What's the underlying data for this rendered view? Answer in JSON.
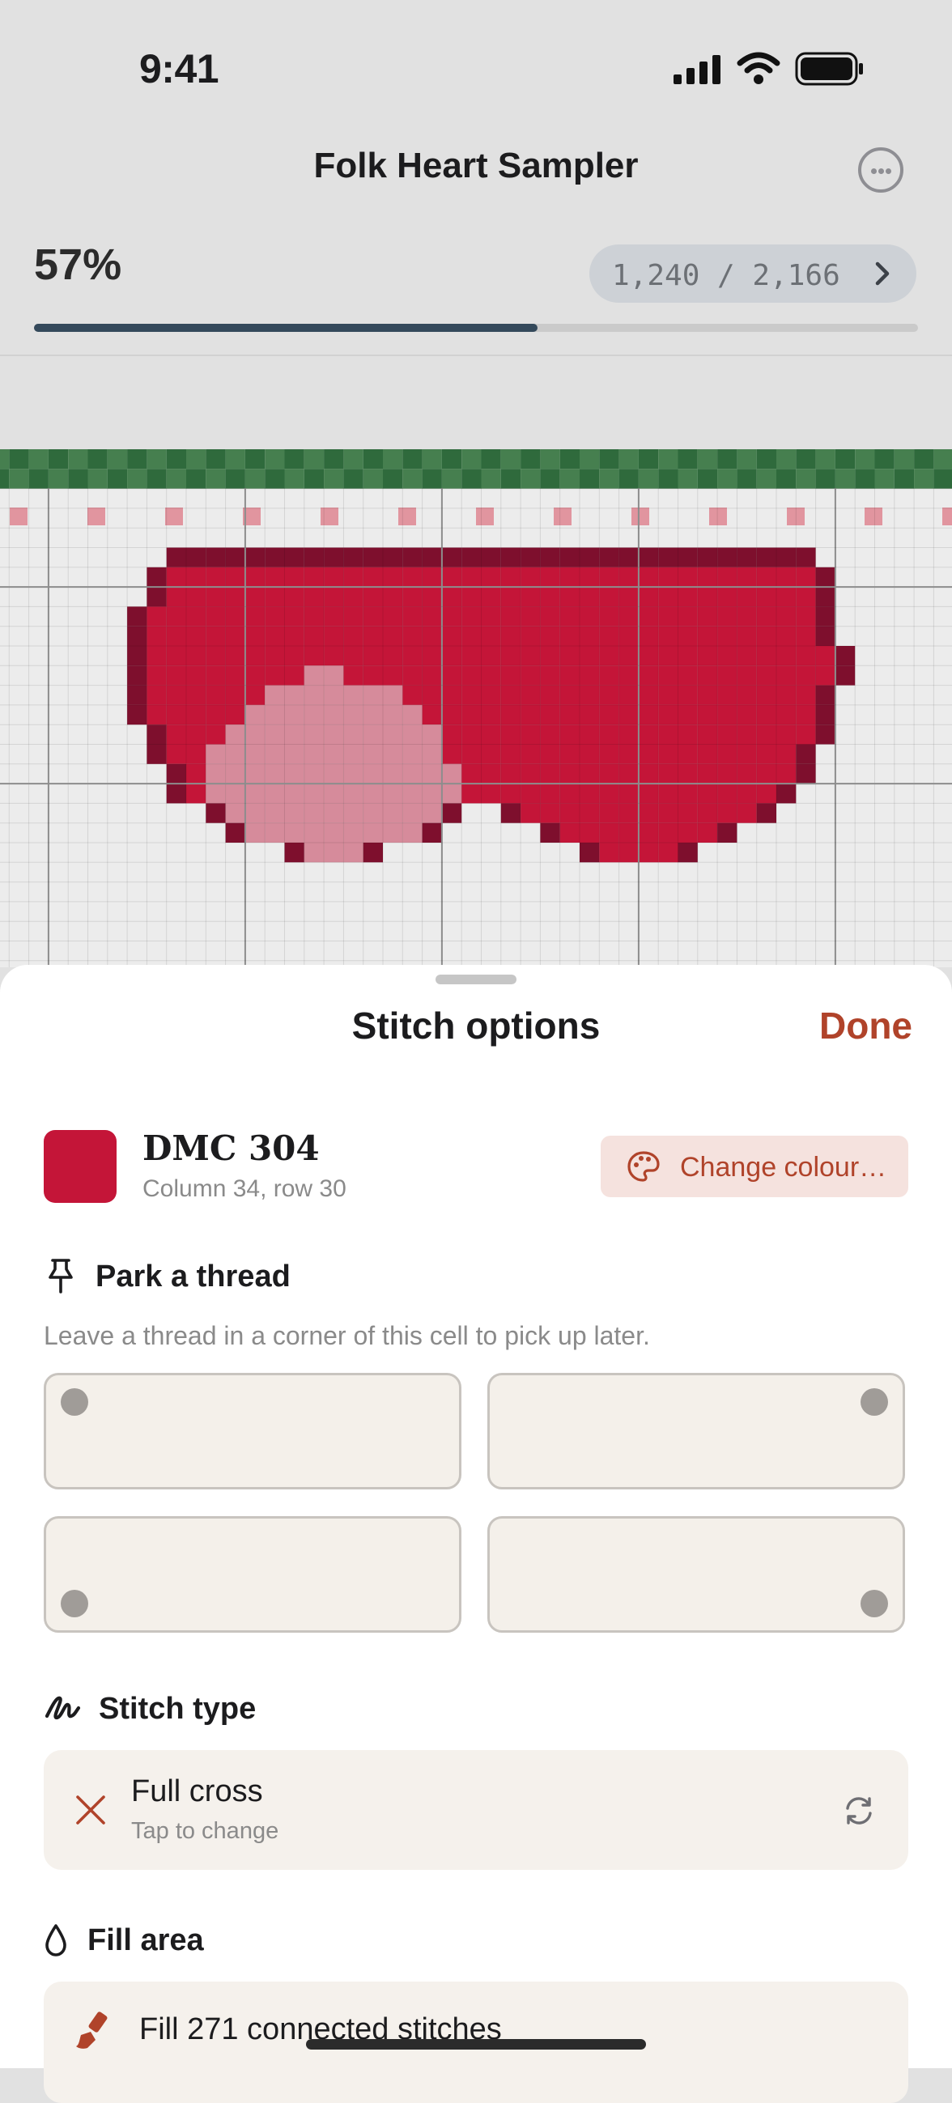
{
  "status_bar": {
    "time": "9:41"
  },
  "header": {
    "title": "Folk Heart Sampler",
    "progress_label": "57%",
    "progress_value": 0.57,
    "stitch_count": "1,240 / 2,166"
  },
  "sheet": {
    "title": "Stitch options",
    "done_label": "Done",
    "color": {
      "name": "DMC 304",
      "location": "Column 34, row 30",
      "hex": "#c41538",
      "change_label": "Change colour…"
    },
    "park": {
      "title": "Park a thread",
      "hint": "Leave a thread in a corner of this cell to pick up later.",
      "corners": [
        "top-left",
        "top-right",
        "bottom-left",
        "bottom-right"
      ]
    },
    "stitch_type": {
      "title": "Stitch type",
      "value": "Full cross",
      "sub": "Tap to change"
    },
    "fill": {
      "title": "Fill area",
      "action": "Fill 271 connected stitches"
    }
  },
  "icons": {
    "more": "ellipsis-circle-icon",
    "chevron": "chevron-right-icon",
    "palette": "palette-icon",
    "pin": "pin-icon",
    "stitch": "scribble-icon",
    "cross": "x-mark-icon",
    "cycle": "rotate-icon",
    "drop": "drop-icon",
    "brush": "brush-icon"
  },
  "colors": {
    "accent": "#b0432a",
    "heart_red": "#c41538",
    "heart_dark": "#7e0f2d",
    "heart_light": "#d68b9b",
    "border_green": "#467f4f",
    "border_green_dark": "#2f6a3c",
    "pink_marker": "#e1959f",
    "progress": "#34495b"
  }
}
